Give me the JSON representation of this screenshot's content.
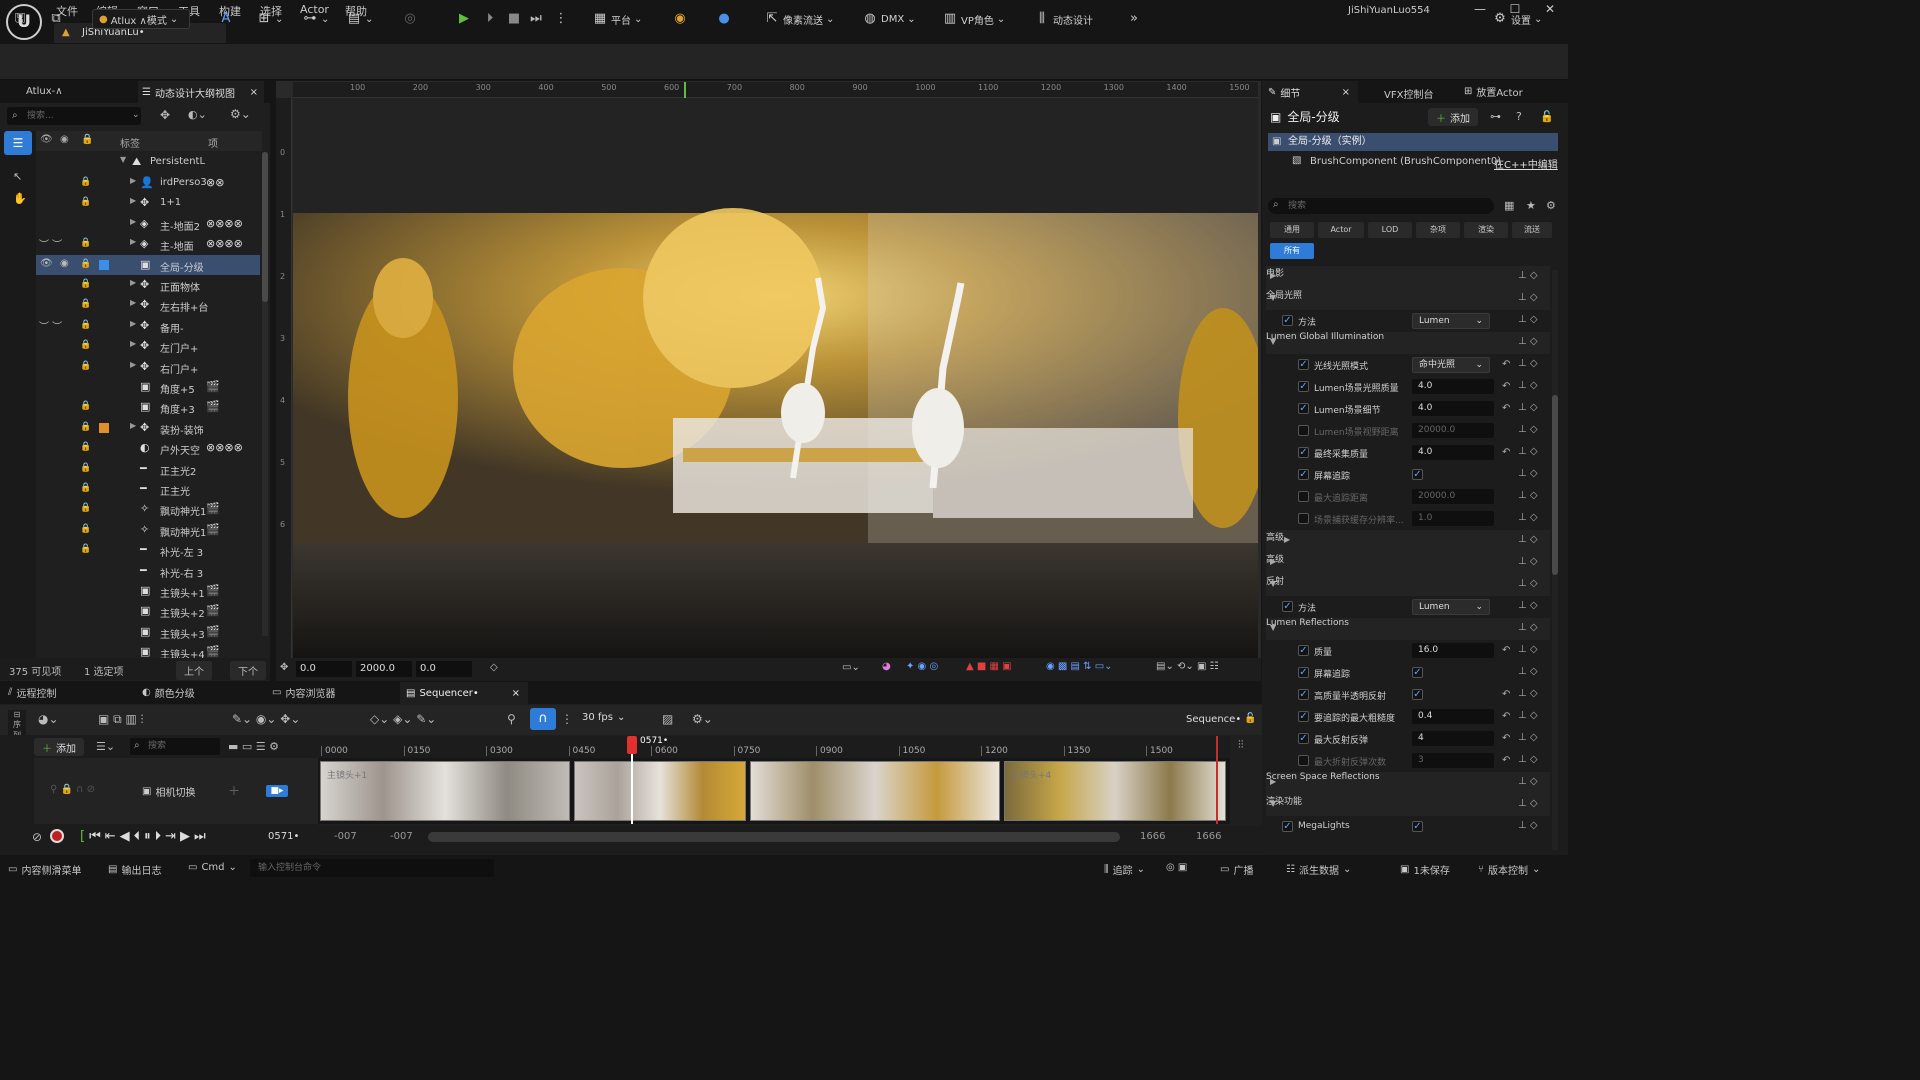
{
  "app": {
    "user": "JiShiYuanLuo554",
    "document_tab": "JiShiYuanLu•"
  },
  "menu": [
    "文件",
    "编辑",
    "窗口",
    "工具",
    "构建",
    "选择",
    "Actor",
    "帮助"
  ],
  "toolbar": {
    "mode": "Atlux ∧模式",
    "platform": "平台",
    "pixel_streaming": "像素流送",
    "dmx": "DMX",
    "vp_role": "VP角色",
    "motion_design": "动态设计",
    "settings": "设置"
  },
  "outliner": {
    "tab1": "Atlux-∧",
    "tab2": "动态设计大纲视图",
    "search_placeholder": "搜索...",
    "col_label": "标签",
    "col_item": "项",
    "root": "PersistentL",
    "rows": [
      {
        "label": "irdPerso3"
      },
      {
        "label": "1+1"
      },
      {
        "label": "主-地面2"
      },
      {
        "label": "主-地面"
      },
      {
        "label": "全局-分级"
      },
      {
        "label": "正面物体"
      },
      {
        "label": "左右排+台"
      },
      {
        "label": "备用-"
      },
      {
        "label": "左门户+"
      },
      {
        "label": "右门户+"
      },
      {
        "label": "角度+5"
      },
      {
        "label": "角度+3"
      },
      {
        "label": "装扮-装饰"
      },
      {
        "label": "户外天空"
      },
      {
        "label": "正主光2"
      },
      {
        "label": "正主光"
      },
      {
        "label": "飘动神光1"
      },
      {
        "label": "飘动神光1"
      },
      {
        "label": "补光-左 3"
      },
      {
        "label": "补光-右 3"
      },
      {
        "label": "主镜头+1"
      },
      {
        "label": "主镜头+2"
      },
      {
        "label": "主镜头+3"
      },
      {
        "label": "主镜头+4"
      }
    ],
    "footer": {
      "visible": "375 可见项",
      "selected": "1 选定项",
      "up": "上个",
      "down": "下个"
    }
  },
  "viewport": {
    "ruler_top": [
      "100",
      "200",
      "300",
      "400",
      "500",
      "600",
      "700",
      "800",
      "900",
      "1000",
      "1100",
      "1200",
      "1300",
      "1400",
      "1500"
    ],
    "ruler_left": [
      "0",
      "1",
      "2",
      "3",
      "4",
      "5",
      "6"
    ],
    "field1": "0.0",
    "field2": "2000.0",
    "field3": "0.0"
  },
  "details": {
    "tab1": "细节",
    "tab2": "VFX控制台",
    "tab3": "放置Actor",
    "title": "全局-分级",
    "add": "添加",
    "instance": "全局-分级（实例）",
    "component": "BrushComponent (BrushComponent0)",
    "edit_cpp": "在C++中编辑",
    "search_placeholder": "搜索",
    "filters": [
      "通用",
      "Actor",
      "LOD",
      "杂项",
      "渲染",
      "流送"
    ],
    "all": "所有",
    "sections": {
      "film": "电影",
      "global_illum": "全局光照",
      "lumen_gi": "Lumen Global Illumination",
      "advanced1": "高级",
      "advanced2": "高级",
      "reflection": "反射",
      "lumen_refl": "Lumen Reflections",
      "ssr": "Screen Space Reflections",
      "render_features": "渲染功能"
    },
    "props": {
      "gi_method": {
        "label": "方法",
        "value": "Lumen"
      },
      "ray_mode": {
        "label": "光线光照模式",
        "value": "命中光照"
      },
      "scene_quality": {
        "label": "Lumen场景光照质量",
        "value": "4.0"
      },
      "scene_detail": {
        "label": "Lumen场景细节",
        "value": "4.0"
      },
      "scene_view_dist": {
        "label": "Lumen场景视野距离",
        "value": "20000.0"
      },
      "final_gather": {
        "label": "最终采集质量",
        "value": "4.0"
      },
      "screen_trace": {
        "label": "屏幕追踪"
      },
      "max_trace_dist": {
        "label": "最大追踪距离",
        "value": "20000.0"
      },
      "scene_cache_res": {
        "label": "场景捕获缓存分辨率...",
        "value": "1.0"
      },
      "refl_method": {
        "label": "方法",
        "value": "Lumen"
      },
      "quality": {
        "label": "质量",
        "value": "16.0"
      },
      "refl_screen_trace": {
        "label": "屏幕追踪"
      },
      "hq_translucency": {
        "label": "高质量半透明反射"
      },
      "max_roughness": {
        "label": "要追踪的最大粗糙度",
        "value": "0.4"
      },
      "max_bounce": {
        "label": "最大反射反弹",
        "value": "4"
      },
      "max_refraction": {
        "label": "最大折射反弹次数",
        "value": "3"
      },
      "megalights": {
        "label": "MegaLights"
      }
    }
  },
  "bottom": {
    "tabs": [
      "远程控制",
      "颜色分级",
      "内容浏览器",
      "Sequencer•"
    ],
    "fps": "30 fps",
    "sequence_name": "Sequence•",
    "add": "添加",
    "search_placeholder": "搜索",
    "track_label": "相机切换",
    "timeline_ticks": [
      "0000",
      "0150",
      "0300",
      "0450",
      "0600",
      "0750",
      "0900",
      "1050",
      "1200",
      "1350",
      "1500"
    ],
    "playhead": "0571•",
    "current_frame": "0571•",
    "range_left1": "-007",
    "range_left2": "-007",
    "range_right1": "1666",
    "range_right2": "1666",
    "clip_labels": [
      "主镜头+1",
      "主镜头+4"
    ]
  },
  "status": {
    "drawer": "内容侧滑菜单",
    "log": "输出日志",
    "cmd": "Cmd",
    "console_placeholder": "输入控制台命令",
    "trace": "追踪",
    "broadcast": "广播",
    "derived": "派生数据",
    "unsaved": "1未保存",
    "version": "版本控制"
  },
  "colors": {
    "accent": "#2f7bd8",
    "selection": "#3a4f6f",
    "playhead": "#e03030",
    "play_green": "#5fbf3a"
  }
}
